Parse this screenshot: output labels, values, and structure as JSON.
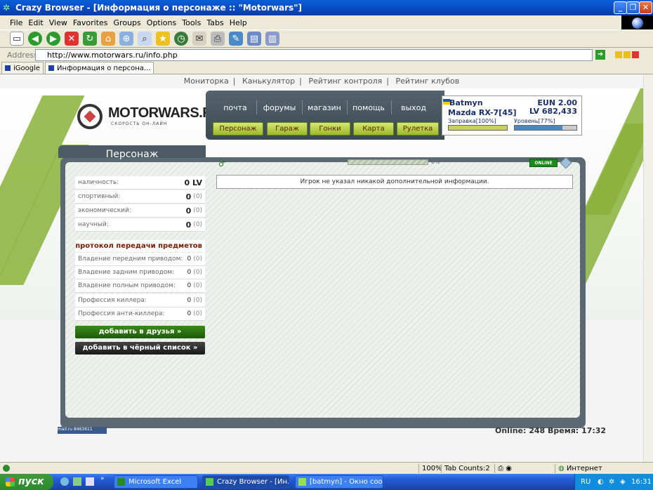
{
  "window": {
    "title": "Crazy Browser - [Информация о персонаже :: \"Motorwars\"]"
  },
  "menu": [
    "File",
    "Edit",
    "View",
    "Favorites",
    "Groups",
    "Options",
    "Tools",
    "Tabs",
    "Help"
  ],
  "address": {
    "label": "Address",
    "url": "http://www.motorwars.ru/info.php"
  },
  "tabs": [
    {
      "label": "iGoogle"
    },
    {
      "label": "Информация о персона..."
    }
  ],
  "site": {
    "topnav": [
      "Мониторка",
      "Канькулятор",
      "Рейтинг контроля",
      "Рейтинг клубов"
    ],
    "topnav_sep": "|",
    "logo_name": "MOTORWARS.RU",
    "logo_sub": "СКОРОСТЬ ОН-ЛАЙН",
    "nav": [
      "почта",
      "форумы",
      "магазин",
      "помощь",
      "выход"
    ],
    "buttons": [
      "Персонаж",
      "Гараж",
      "Гонки",
      "Карта",
      "Рулетка"
    ],
    "user": {
      "name": "Batmyn",
      "car": "Mazda RX-7[45]",
      "eun": "EUN 2.00",
      "lv": "LV 682,433",
      "fuel_label": "Заправка[100%]",
      "fuel_value": 100,
      "level_label": "Уровень[77%]",
      "level_value": 77
    },
    "panel_title": "Персонаж",
    "stats": [
      {
        "label": "наличность:",
        "value": "0 LV",
        "paren": ""
      },
      {
        "label": "спортивный:",
        "value": "0",
        "paren": "(0)"
      },
      {
        "label": "экономический:",
        "value": "0",
        "paren": "(0)"
      },
      {
        "label": "научный:",
        "value": "0",
        "paren": "(0)"
      }
    ],
    "protocol_link": "протокол передачи предметов »",
    "skills": [
      {
        "label": "Владение передним приводом:",
        "value": "0",
        "paren": "(0)"
      },
      {
        "label": "Владение задним приводом:",
        "value": "0",
        "paren": "(0)"
      },
      {
        "label": "Владение полным приводом:",
        "value": "0",
        "paren": "(0)"
      },
      {
        "label": "Профессия киллера:",
        "value": "0",
        "paren": "(0)"
      },
      {
        "label": "Профессия анти-киллера:",
        "value": "0",
        "paren": "(0)"
      }
    ],
    "add_friend": "добавить в друзья »",
    "add_blacklist": "добавить в чёрный список »",
    "progress_pct": "0%",
    "online_badge": "ONLINE",
    "no_info": "Игрок не указал никакой дополнительной информации.",
    "footer_counter": "mail.ru 8463611",
    "footer_online": "Online: 248  Время: 17:32",
    "colors": {
      "accent_green": "#9ab82a",
      "panel_dark": "#4b5a63",
      "user_blue": "#1a2e6a"
    }
  },
  "statusbar": {
    "zoom": "100%",
    "tab_counts": "Tab Counts:2",
    "zone": "Интернет"
  },
  "taskbar": {
    "start": "пуск",
    "items": [
      "Microsoft Excel",
      "Crazy Browser - [Ин...",
      "[batmyn] - Окно соо..."
    ],
    "lang": "RU",
    "time": "16:31"
  }
}
